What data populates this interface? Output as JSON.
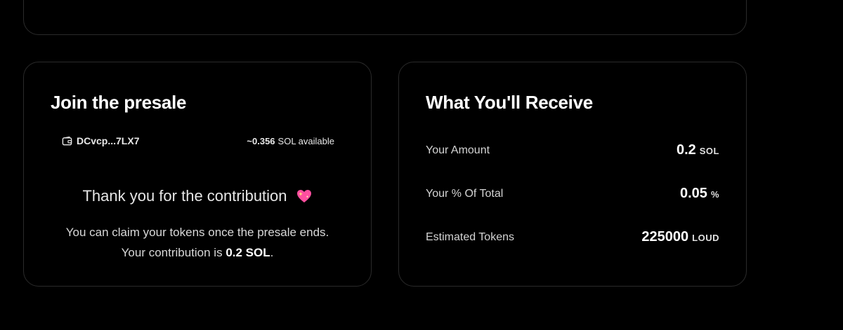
{
  "join": {
    "title": "Join the presale",
    "wallet_address": "DCvcp...7LX7",
    "available_amount": "~0.356",
    "available_suffix": "SOL available",
    "thanks": "Thank you for the contribution",
    "claim_line": "You can claim your tokens once the presale ends.",
    "contribution_prefix": "Your contribution is",
    "contribution_value": "0.2 SOL",
    "contribution_suffix": "."
  },
  "receive": {
    "title": "What You'll Receive",
    "rows": [
      {
        "label": "Your Amount",
        "value": "0.2",
        "unit": "SOL"
      },
      {
        "label": "Your % Of Total",
        "value": "0.05",
        "unit": "%"
      },
      {
        "label": "Estimated Tokens",
        "value": "225000",
        "unit": "LOUD"
      }
    ]
  },
  "icons": {
    "wallet": "wallet-icon",
    "heart": "sparkling-heart-icon"
  },
  "colors": {
    "background": "#000000",
    "card_border": "#2a2a2a",
    "heart": "#ff4fa0"
  }
}
